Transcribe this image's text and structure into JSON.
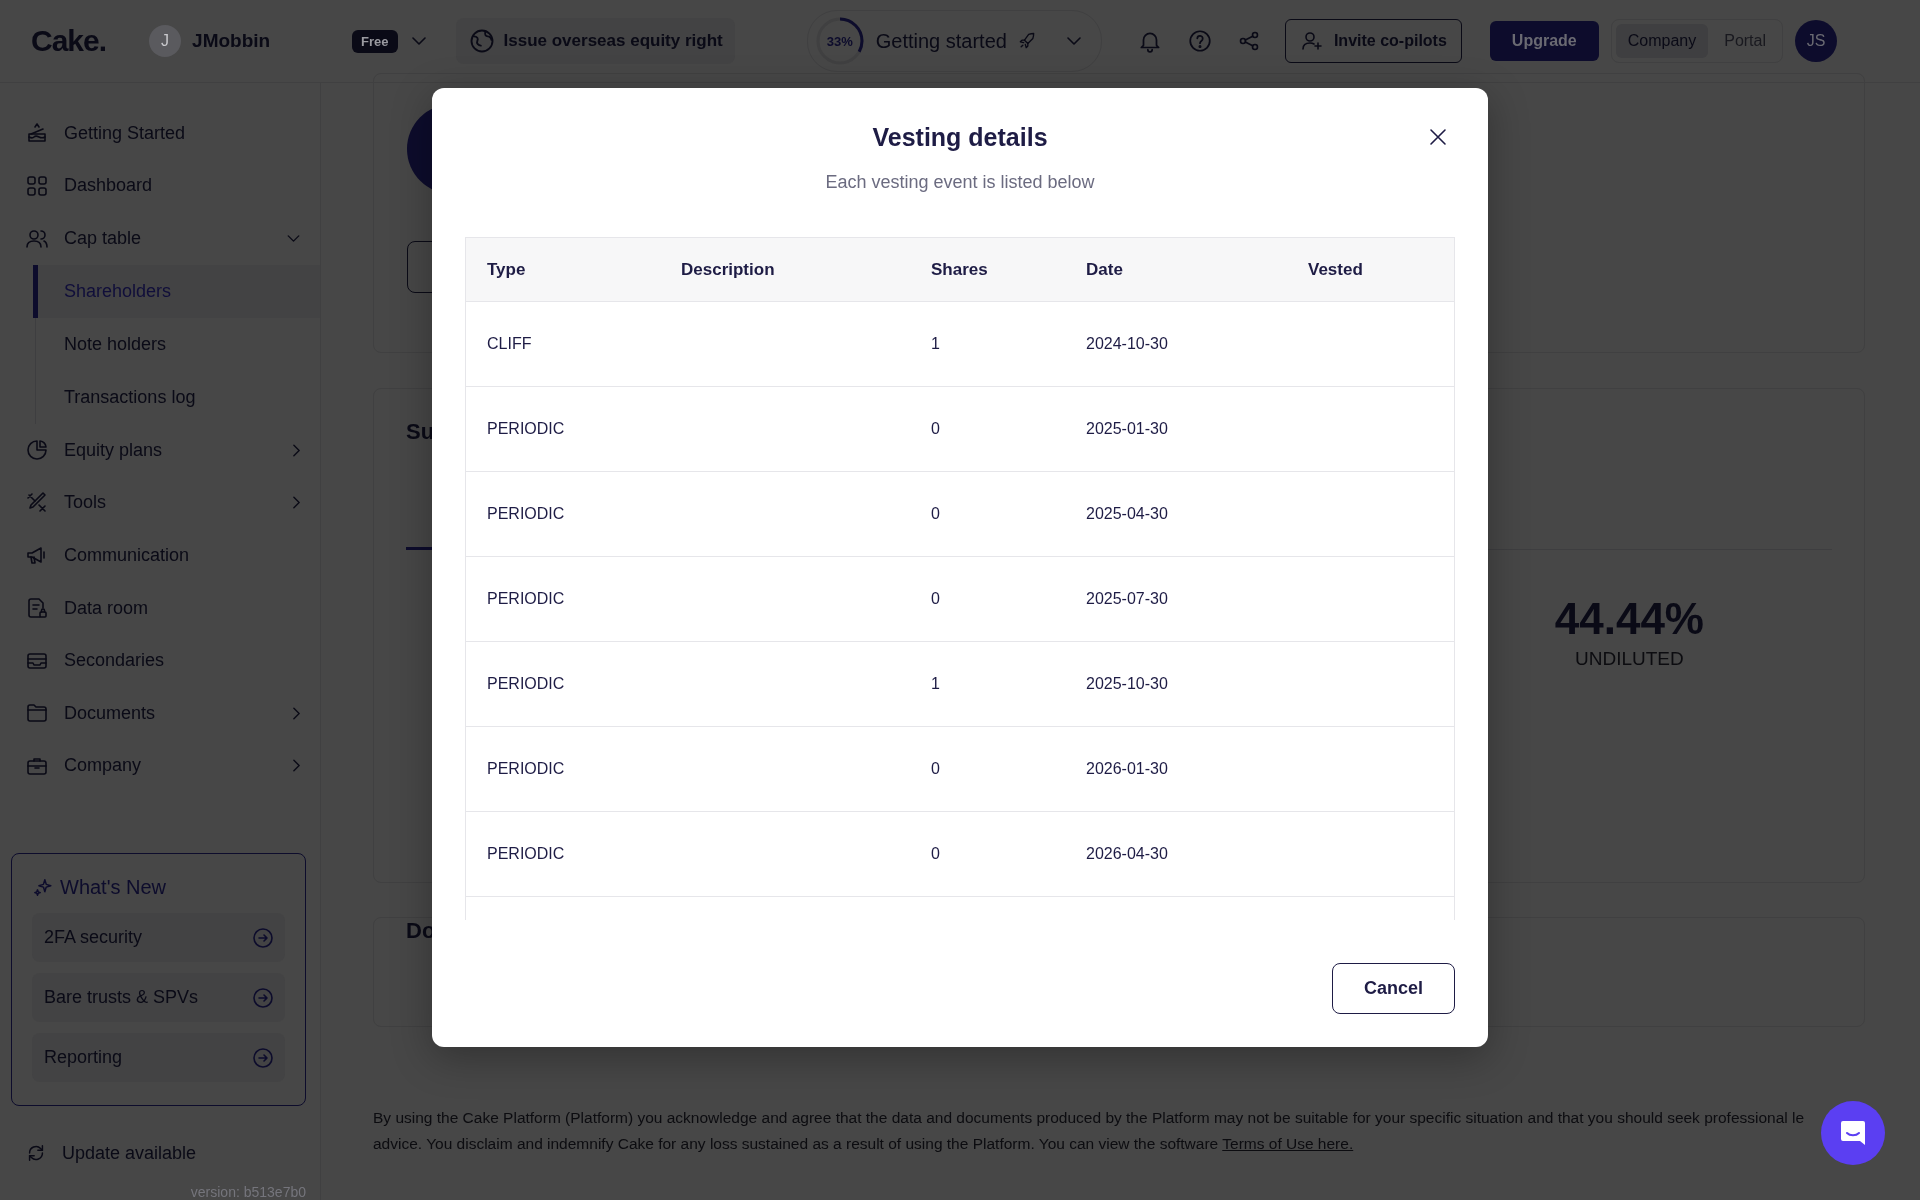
{
  "topbar": {
    "logo": "Cake.",
    "account": {
      "initial": "J",
      "name": "JMobbin",
      "plan": "Free"
    },
    "task": "Issue overseas equity right",
    "progress": {
      "level": 0.33,
      "percent": "33%",
      "label": "Getting started"
    },
    "invite": "Invite co-pilots",
    "upgrade": "Upgrade",
    "views": [
      {
        "label": "Company",
        "selected": true
      },
      {
        "label": "Portal",
        "selected": false
      }
    ],
    "user_initials": "JS"
  },
  "sidebar": {
    "items": [
      {
        "label": "Getting Started",
        "selected": false
      },
      {
        "label": "Dashboard",
        "selected": false
      },
      {
        "label": "Cap table",
        "selected": false,
        "expanded": true,
        "children": [
          {
            "label": "Shareholders",
            "selected": true
          },
          {
            "label": "Note holders",
            "selected": false
          },
          {
            "label": "Transactions log",
            "selected": false
          }
        ]
      },
      {
        "label": "Equity plans",
        "selected": false,
        "expanded": false
      },
      {
        "label": "Tools",
        "selected": false,
        "expanded": false
      },
      {
        "label": "Communication",
        "selected": false
      },
      {
        "label": "Data room",
        "selected": false
      },
      {
        "label": "Secondaries",
        "selected": false
      },
      {
        "label": "Documents",
        "selected": false,
        "expanded": false
      },
      {
        "label": "Company",
        "selected": false,
        "expanded": false
      }
    ],
    "whats_new": {
      "title": "What's New",
      "items": [
        "2FA security",
        "Bare trusts & SPVs",
        "Reporting"
      ]
    },
    "update": "Update available",
    "version": "version: b513e7b0"
  },
  "main": {
    "summary_heading": "Su",
    "stat": {
      "value": "44.44%",
      "label": "UNDILUTED"
    },
    "documents_heading": "Do"
  },
  "footer": {
    "lines": [
      "By using the Cake Platform (Platform) you acknowledge and agree that the data and documents produced by the Platform may not be suitable for your specific situation and that you should seek professional le",
      "advice. You disclaim and indemnify Cake for any loss sustained as a result of using the Platform. You can view the software"
    ],
    "link": "Terms of Use here."
  },
  "modal": {
    "title": "Vesting details",
    "subtitle": "Each vesting event is listed below",
    "columns": [
      "Type",
      "Description",
      "Shares",
      "Date",
      "Vested"
    ],
    "rows": [
      {
        "type": "CLIFF",
        "shares": "1",
        "date": "2024-10-30"
      },
      {
        "type": "PERIODIC",
        "shares": "0",
        "date": "2025-01-30"
      },
      {
        "type": "PERIODIC",
        "shares": "0",
        "date": "2025-04-30"
      },
      {
        "type": "PERIODIC",
        "shares": "0",
        "date": "2025-07-30"
      },
      {
        "type": "PERIODIC",
        "shares": "1",
        "date": "2025-10-30"
      },
      {
        "type": "PERIODIC",
        "shares": "0",
        "date": "2026-01-30"
      },
      {
        "type": "PERIODIC",
        "shares": "0",
        "date": "2026-04-30"
      }
    ],
    "cancel": "Cancel"
  }
}
